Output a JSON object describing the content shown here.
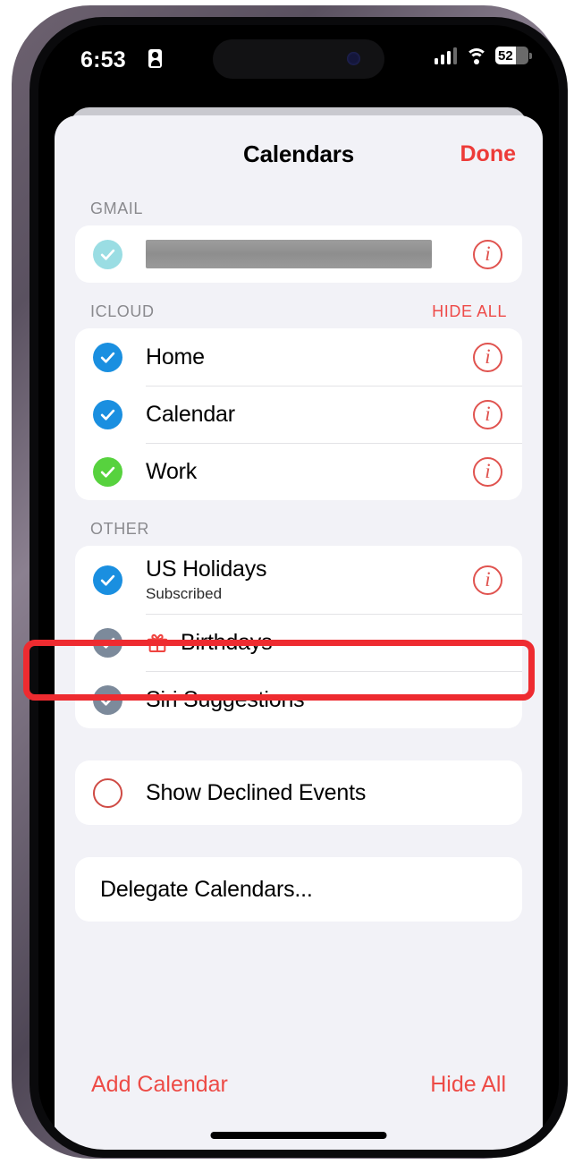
{
  "status_bar": {
    "time": "6:53",
    "lock_icon": "recording-indicator-icon",
    "signal_icon": "cellular-signal-icon",
    "wifi_icon": "wifi-icon",
    "battery_percent": "52"
  },
  "nav": {
    "title": "Calendars",
    "done_label": "Done"
  },
  "sections": [
    {
      "title": "GMAIL",
      "action": "",
      "rows": [
        {
          "label": "",
          "redacted": true,
          "sub": "",
          "check_style": "cyan",
          "checked": true,
          "info": true,
          "gift": false
        }
      ]
    },
    {
      "title": "ICLOUD",
      "action": "HIDE ALL",
      "rows": [
        {
          "label": "Home",
          "sub": "",
          "check_style": "blue",
          "checked": true,
          "info": true,
          "gift": false
        },
        {
          "label": "Calendar",
          "sub": "",
          "check_style": "blue",
          "checked": true,
          "info": true,
          "gift": false
        },
        {
          "label": "Work",
          "sub": "",
          "check_style": "green",
          "checked": true,
          "info": true,
          "gift": false
        }
      ]
    },
    {
      "title": "OTHER",
      "action": "",
      "rows": [
        {
          "label": "US Holidays",
          "sub": "Subscribed",
          "check_style": "blue",
          "checked": true,
          "info": true,
          "gift": false
        },
        {
          "label": "Birthdays",
          "sub": "",
          "check_style": "slate",
          "checked": true,
          "info": false,
          "gift": true
        },
        {
          "label": "Siri Suggestions",
          "sub": "",
          "check_style": "slate",
          "checked": true,
          "info": false,
          "gift": false
        }
      ]
    }
  ],
  "options": {
    "show_declined_label": "Show Declined Events",
    "show_declined_checked": false,
    "delegate_label": "Delegate Calendars..."
  },
  "toolbar": {
    "add_calendar_label": "Add Calendar",
    "hide_all_label": "Hide All"
  },
  "annotation": {
    "highlight_target": "Birthdays",
    "highlight_color": "#ee2b30"
  }
}
